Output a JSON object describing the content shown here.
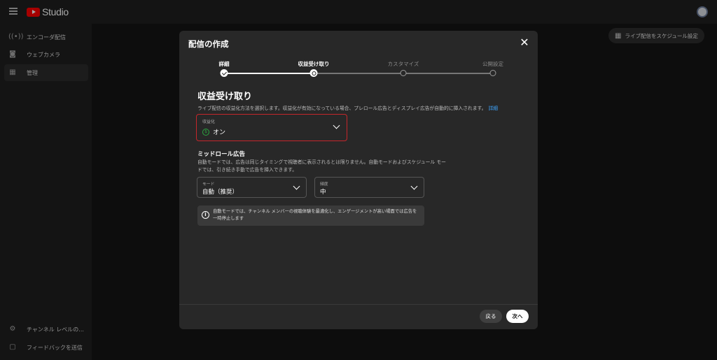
{
  "app": {
    "logo_text": "Studio"
  },
  "sidebar": {
    "items": [
      {
        "label": "エンコーダ配信",
        "icon": "broadcast-icon"
      },
      {
        "label": "ウェブカメラ",
        "icon": "camera-icon"
      },
      {
        "label": "管理",
        "icon": "calendar-icon"
      }
    ],
    "bottom": [
      {
        "label": "チャンネル レベルの...",
        "icon": "gear-icon"
      },
      {
        "label": "フィードバックを送信",
        "icon": "feedback-icon"
      }
    ]
  },
  "header": {
    "schedule_label": "ライブ配信をスケジュール設定"
  },
  "dialog": {
    "title": "配信の作成",
    "steps": [
      {
        "label": "詳細",
        "state": "done"
      },
      {
        "label": "収益受け取り",
        "state": "current"
      },
      {
        "label": "カスタマイズ",
        "state": "todo"
      },
      {
        "label": "公開設定",
        "state": "todo"
      }
    ],
    "heading": "収益受け取り",
    "description": "ライブ配信の収益化方法を選択します。収益化が有効になっている場合、プレロール広告とディスプレイ広告が自動的に挿入されます。",
    "details_link": "詳細",
    "monetization": {
      "label": "収益化",
      "value": "オン"
    },
    "midroll": {
      "heading": "ミッドロール広告",
      "description": "自動モードでは、広告は同じタイミングで視聴者に表示されるとは限りません。自動モードおよびスケジュール モードでは、引き続き手動で広告を挿入できます。",
      "mode": {
        "label": "モード",
        "value": "自動（推奨）"
      },
      "frequency": {
        "label": "頻度",
        "value": "中"
      }
    },
    "info": "自動モードでは、チャンネル メンバーの視聴体験を最適化し、エンゲージメントが高い場面では広告を一時停止します",
    "back_label": "戻る",
    "next_label": "次へ"
  },
  "colors": {
    "accent_red": "#c5262b",
    "link_blue": "#3ea6ff",
    "money_green": "#2ba640",
    "youtube_red": "#ff0000"
  }
}
